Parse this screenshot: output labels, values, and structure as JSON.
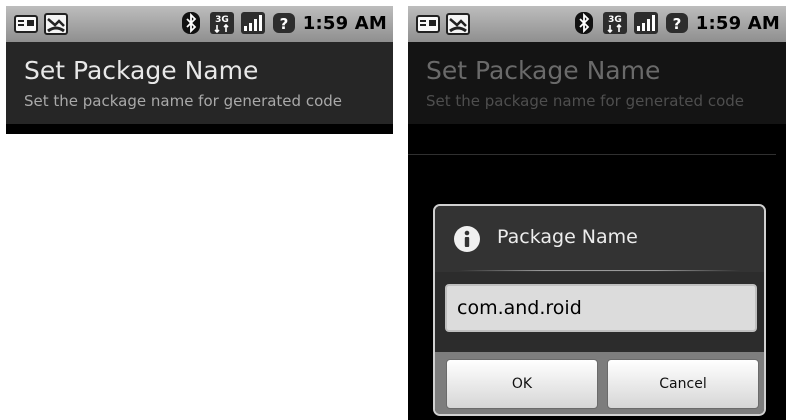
{
  "status_bar": {
    "time": "1:59 AM",
    "left_icons": [
      "notification-card-icon",
      "missed-call-icon"
    ],
    "right_icons": [
      "bluetooth-icon",
      "network-3g-icon",
      "signal-bars-icon",
      "battery-unknown-icon"
    ]
  },
  "app": {
    "title": "Set Package Name",
    "subtitle": "Set the package name for generated code"
  },
  "dialog": {
    "title": "Package Name",
    "input_value": "com.and.roid",
    "ok_label": "OK",
    "cancel_label": "Cancel"
  }
}
